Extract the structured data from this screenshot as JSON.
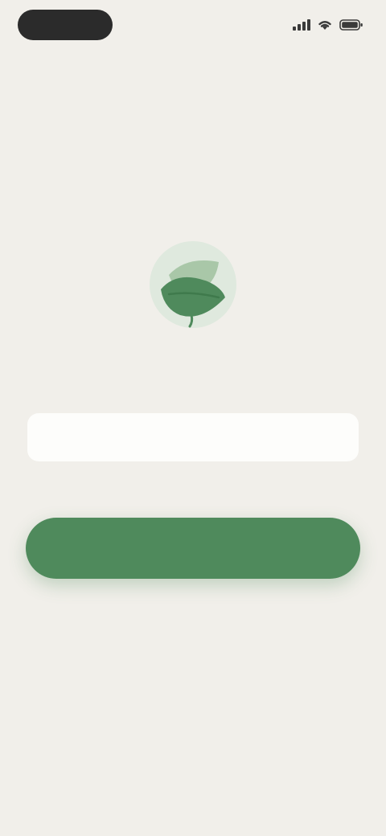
{
  "colors": {
    "background": "#f1efea",
    "accent": "#4f8a5c",
    "input_background": "#fdfdfb"
  },
  "status_bar": {
    "time": "",
    "icons": [
      "signal-icon",
      "wifi-icon",
      "battery-icon"
    ]
  },
  "brand": {
    "logo_icon": "leaf-logo-icon",
    "title": ""
  },
  "form": {
    "name_placeholder": "",
    "name_value": "",
    "helper_text": ""
  },
  "actions": {
    "continue_label": ""
  },
  "footer": {
    "line_1": "",
    "line_2": ""
  }
}
